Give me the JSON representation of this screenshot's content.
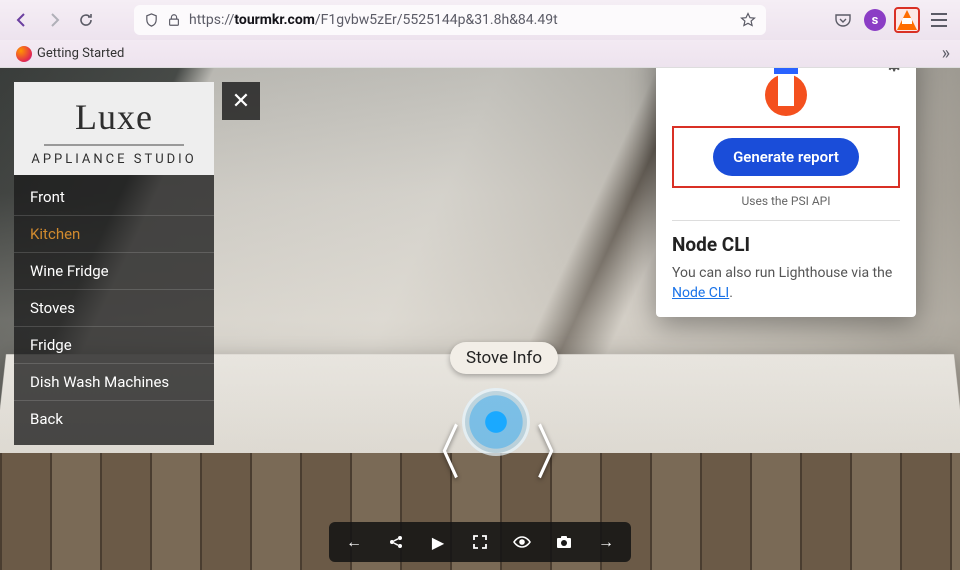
{
  "browser": {
    "url_prefix": "https://",
    "url_host": "tourmkr.com",
    "url_path": "/F1gvbw5zEr/5525144p&31.8h&84.49t",
    "bookmark": "Getting Started"
  },
  "logo": {
    "main": "Luxe",
    "sub": "APPLIANCE STUDIO"
  },
  "menu": {
    "items": [
      {
        "label": "Front",
        "active": false
      },
      {
        "label": "Kitchen",
        "active": true
      },
      {
        "label": "Wine Fridge",
        "active": false
      },
      {
        "label": "Stoves",
        "active": false
      },
      {
        "label": "Fridge",
        "active": false
      },
      {
        "label": "Dish Wash Machines",
        "active": false
      },
      {
        "label": "Back",
        "active": false
      }
    ]
  },
  "hotspot": {
    "label": "Stove Info"
  },
  "lighthouse": {
    "button": "Generate report",
    "psi": "Uses the PSI API",
    "heading": "Node CLI",
    "body_pre": "You can also run Lighthouse via the ",
    "link": "Node CLI",
    "body_post": "."
  }
}
